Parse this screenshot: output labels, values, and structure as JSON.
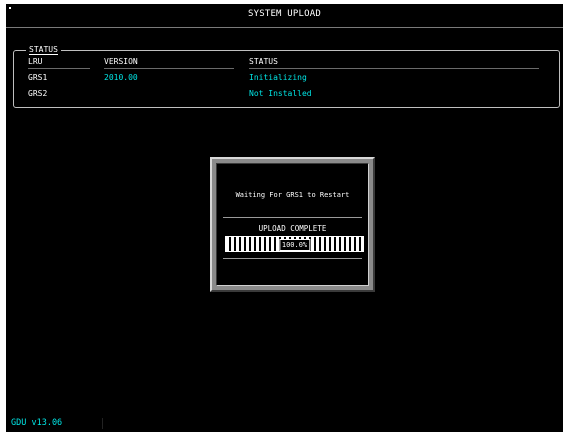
{
  "page": {
    "title": "SYSTEM UPLOAD"
  },
  "status": {
    "legend": "STATUS",
    "columns": {
      "lru": "LRU",
      "version": "VERSION",
      "status": "STATUS"
    },
    "rows": [
      {
        "lru": "GRS1",
        "version": "2010.00",
        "status": "Initializing"
      },
      {
        "lru": "GRS2",
        "version": "",
        "status": "Not Installed"
      }
    ]
  },
  "dialog": {
    "message": "Waiting For GRS1 to Restart",
    "complete_label": "UPLOAD COMPLETE",
    "progress_percent": 100,
    "progress_label": "100.0%"
  },
  "footer": {
    "software_version": "GDU v13.06"
  },
  "colors": {
    "background": "#000000",
    "text": "#ffffff",
    "accent_cyan": "#00e5e5",
    "bezel_gray": "#8a8a8a"
  }
}
